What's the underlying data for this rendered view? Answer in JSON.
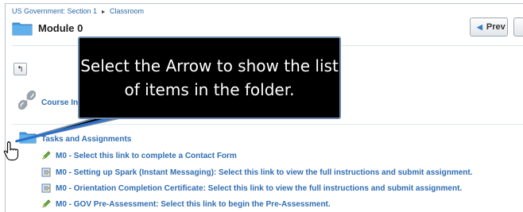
{
  "breadcrumb": {
    "section": "US Government: Section 1",
    "separator": "►",
    "current": "Classroom"
  },
  "page": {
    "title": "Module 0"
  },
  "nav": {
    "prev_label": "Prev"
  },
  "content": {
    "course_link": "Course Int",
    "folder_label": "Tasks and Assignments",
    "items": [
      {
        "label": "M0 - Select this link to complete a Contact Form",
        "icon": "pencil-icon"
      },
      {
        "label": "M0 - Setting up Spark (Instant Messaging): Select this link to view the full instructions and submit assignment.",
        "icon": "assignment-icon"
      },
      {
        "label": "M0 - Orientation Completion Certificate: Select this link to view the full instructions and submit assignment.",
        "icon": "assignment-icon"
      },
      {
        "label": "M0 - GOV Pre-Assessment: Select this link to begin the Pre-Assessment.",
        "icon": "pencil-icon"
      }
    ]
  },
  "callout": {
    "text": "Select the Arrow to show the list of items in the folder."
  },
  "colors": {
    "link": "#2f6db3",
    "callout_bg": "#000000",
    "callout_border": "#6d87a8",
    "arrow": "#2a72c9"
  }
}
